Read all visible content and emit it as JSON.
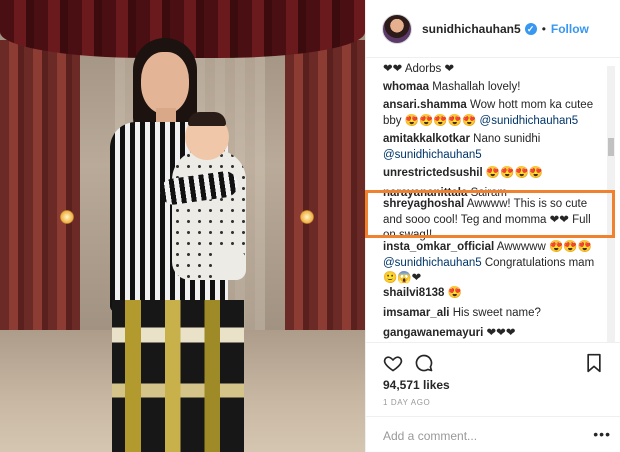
{
  "header": {
    "username": "sunidhichauhan5",
    "verified_icon": "verified-badge-icon",
    "separator": "•",
    "follow_label": "Follow"
  },
  "comments": [
    {
      "user": "",
      "text": "❤❤ Adorbs ❤"
    },
    {
      "user": "whomaa",
      "text": "Mashallah lovely!"
    },
    {
      "user": "ansari.shamma",
      "text": "Wow hott mom ka cutee bby 😍😍😍😍😍",
      "mention": "@sunidhichauhan5"
    },
    {
      "user": "amitakkalkotkar",
      "text": "Nano sunidhi",
      "mention": "@sunidhichauhan5"
    },
    {
      "user": "unrestrictedsushil",
      "text": "😍😍😍😍"
    },
    {
      "user": "narayananittala",
      "text": "Sairam"
    },
    {
      "user": "shreyaghoshal",
      "text": "Awwww! This is so cute and sooo cool! Teg and momma ❤❤ Full on swag!!"
    },
    {
      "user": "insta_omkar_official",
      "text": "Awwwww 😍😍😍",
      "mention": "@sunidhichauhan5",
      "text2": "Congratulations mam 🙂😱❤"
    },
    {
      "user": "shailvi8138",
      "text": "😍"
    },
    {
      "user": "imsamar_ali",
      "text": "His sweet name?"
    },
    {
      "user": "gangawanemayuri",
      "text": "❤❤❤"
    }
  ],
  "actions": {
    "like_icon": "heart-icon",
    "comment_icon": "comment-icon",
    "save_icon": "bookmark-icon"
  },
  "likes": "94,571 likes",
  "timestamp": "1 DAY AGO",
  "add_comment": {
    "placeholder": "Add a comment...",
    "more_label": "•••"
  },
  "colors": {
    "accent": "#3897f0",
    "highlight": "#f0812e",
    "text": "#262626",
    "muted": "#999999"
  }
}
